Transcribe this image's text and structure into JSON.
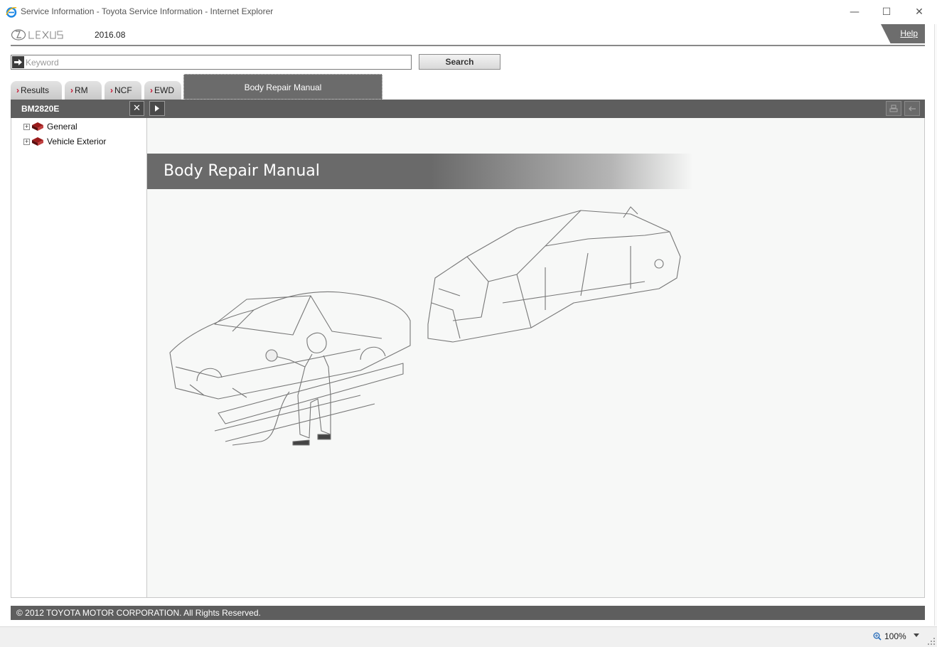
{
  "window": {
    "title": "Service Information - Toyota Service Information - Internet Explorer",
    "minimize_glyph": "—",
    "maximize_glyph": "☐",
    "close_glyph": "✕"
  },
  "header": {
    "version": "2016.08",
    "help_label": "Help"
  },
  "search": {
    "placeholder": "Keyword",
    "value": "",
    "button_label": "Search"
  },
  "tabs": {
    "items": [
      {
        "label": "Results"
      },
      {
        "label": "RM"
      },
      {
        "label": "NCF"
      },
      {
        "label": "EWD"
      }
    ],
    "chevron": "›",
    "active_label": "Body Repair Manual"
  },
  "panel": {
    "manual_code": "BM2820E",
    "close_glyph": "✕"
  },
  "tree": {
    "items": [
      {
        "label": "General",
        "expander": "+"
      },
      {
        "label": "Vehicle Exterior",
        "expander": "+"
      }
    ]
  },
  "main": {
    "banner_title": "Body Repair Manual"
  },
  "footer": {
    "copyright": "© 2012 TOYOTA MOTOR CORPORATION. All Rights Reserved."
  },
  "statusbar": {
    "zoom": "100%"
  },
  "colors": {
    "dark_bar": "#5e5e5e",
    "chevron": "#c8102e",
    "main_bg": "#f7f8f7"
  }
}
